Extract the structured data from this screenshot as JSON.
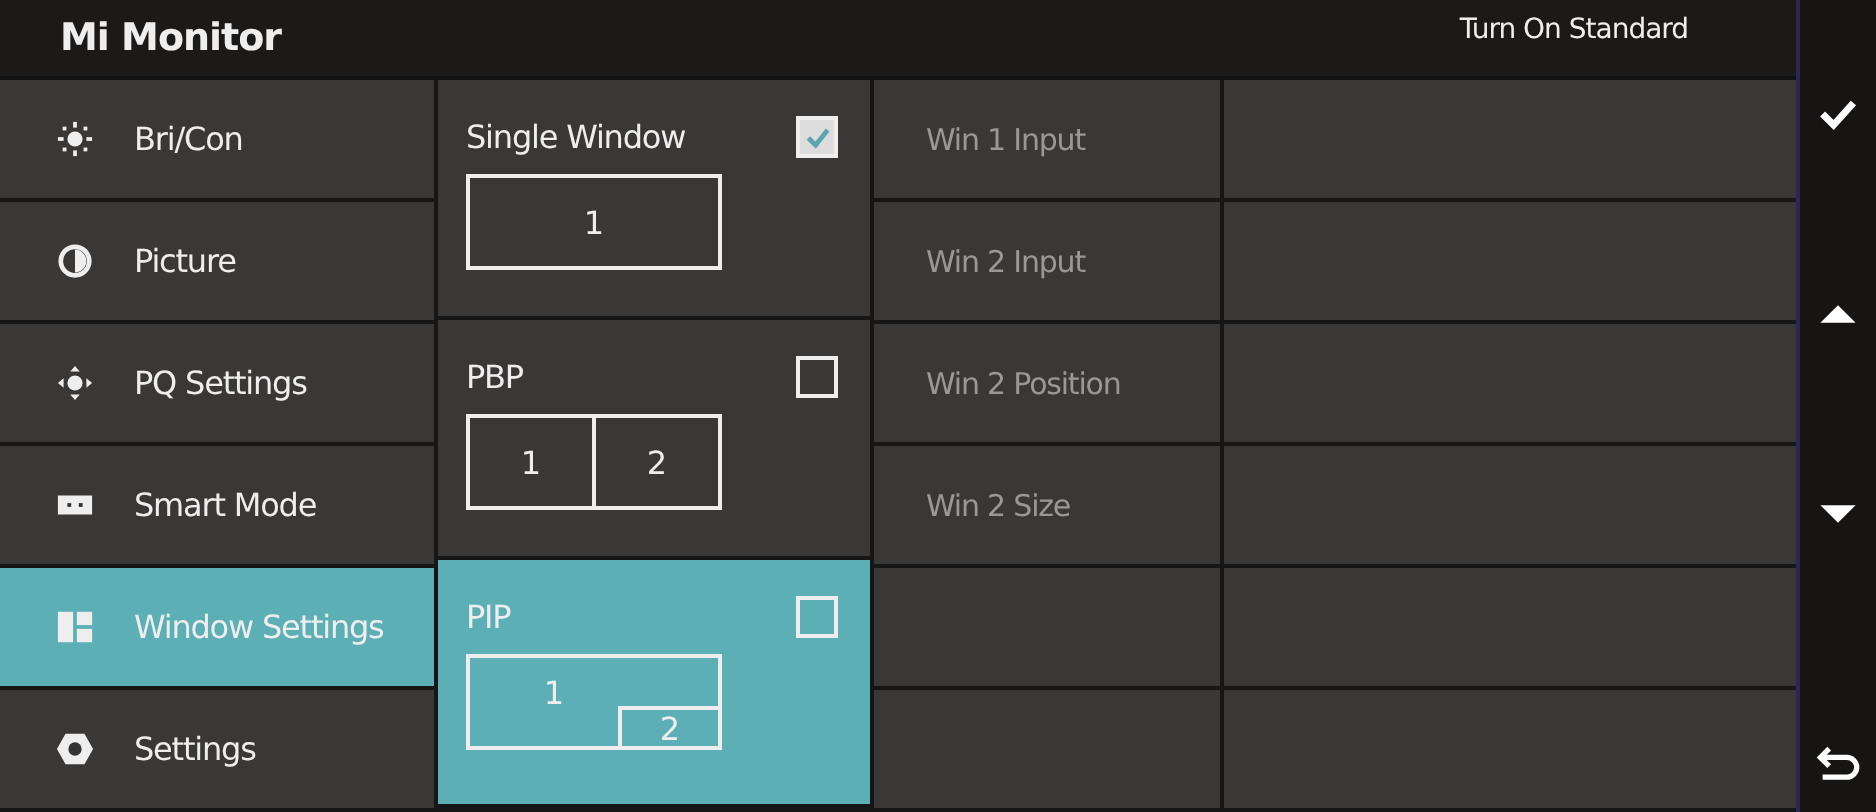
{
  "header": {
    "title": "Mi Monitor",
    "mode": "Turn On Standard"
  },
  "sidebar": {
    "items": [
      {
        "label": "Bri/Con",
        "selected": false
      },
      {
        "label": "Picture",
        "selected": false
      },
      {
        "label": "PQ Settings",
        "selected": false
      },
      {
        "label": "Smart Mode",
        "selected": false
      },
      {
        "label": "Window Settings",
        "selected": true
      },
      {
        "label": "Settings",
        "selected": false
      }
    ]
  },
  "window_modes": [
    {
      "label": "Single Window",
      "kind": "single",
      "checked": true,
      "selected": false,
      "panes": [
        "1"
      ]
    },
    {
      "label": "PBP",
      "kind": "pbp",
      "checked": false,
      "selected": false,
      "panes": [
        "1",
        "2"
      ]
    },
    {
      "label": "PIP",
      "kind": "pip",
      "checked": false,
      "selected": true,
      "panes": [
        "1",
        "2"
      ]
    }
  ],
  "options": [
    {
      "label": "Win 1 Input",
      "disabled": true
    },
    {
      "label": "Win 2 Input",
      "disabled": true
    },
    {
      "label": "Win 2 Position",
      "disabled": true
    },
    {
      "label": "Win 2 Size",
      "disabled": true
    }
  ],
  "keys": [
    {
      "kind": "ok"
    },
    {
      "kind": "up"
    },
    {
      "kind": "down"
    },
    {
      "kind": "back"
    }
  ]
}
